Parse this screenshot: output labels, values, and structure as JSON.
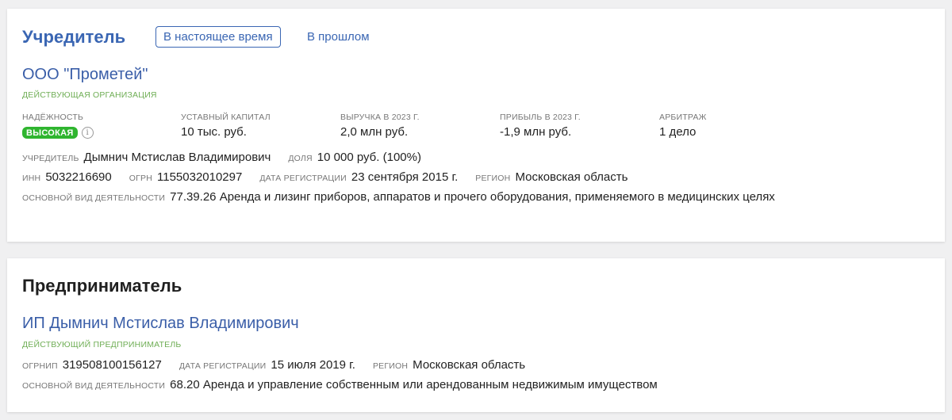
{
  "founder": {
    "title": "Учредитель",
    "tab_current": "В настоящее время",
    "tab_past": "В прошлом",
    "org_name": "ООО \"Прометей\"",
    "org_status": "ДЕЙСТВУЮЩАЯ ОРГАНИЗАЦИЯ",
    "reliability_label": "НАДЁЖНОСТЬ",
    "reliability_value": "ВЫСОКАЯ",
    "metrics": [
      {
        "label": "УСТАВНЫЙ КАПИТАЛ",
        "value": "10 тыс. руб."
      },
      {
        "label": "ВЫРУЧКА В 2023 Г.",
        "value": "2,0 млн руб."
      },
      {
        "label": "ПРИБЫЛЬ В 2023 Г.",
        "value": "-1,9 млн руб."
      },
      {
        "label": "АРБИТРАЖ",
        "value": "1 дело"
      }
    ],
    "founder_label": "УЧРЕДИТЕЛЬ",
    "founder_value": "Дымнич Мстислав Владимирович",
    "share_label": "ДОЛЯ",
    "share_value": "10 000 руб. (100%)",
    "inn_label": "ИНН",
    "inn_value": "5032216690",
    "ogrn_label": "ОГРН",
    "ogrn_value": "1155032010297",
    "reg_label": "ДАТА РЕГИСТРАЦИИ",
    "reg_value": "23 сентября 2015 г.",
    "region_label": "РЕГИОН",
    "region_value": "Московская область",
    "activity_label": "ОСНОВНОЙ ВИД ДЕЯТЕЛЬНОСТИ",
    "activity_value": "77.39.26 Аренда и лизинг приборов, аппаратов и прочего оборудования, применяемого в медицинских целях"
  },
  "entrepreneur": {
    "title": "Предприниматель",
    "name": "ИП Дымнич Мстислав Владимирович",
    "status": "ДЕЙСТВУЮЩИЙ ПРЕДПРИНИМАТЕЛЬ",
    "ogrnip_label": "ОГРНИП",
    "ogrnip_value": "319508100156127",
    "reg_label": "ДАТА РЕГИСТРАЦИИ",
    "reg_value": "15 июля 2019 г.",
    "region_label": "РЕГИОН",
    "region_value": "Московская область",
    "activity_label": "ОСНОВНОЙ ВИД ДЕЯТЕЛЬНОСТИ",
    "activity_value": "68.20 Аренда и управление собственным или арендованным недвижимым имуществом"
  },
  "colors": {
    "accent": "#3a66b3",
    "status_green": "#6fae55",
    "badge_green": "#2fb52f",
    "background": "#f0f0f1"
  }
}
